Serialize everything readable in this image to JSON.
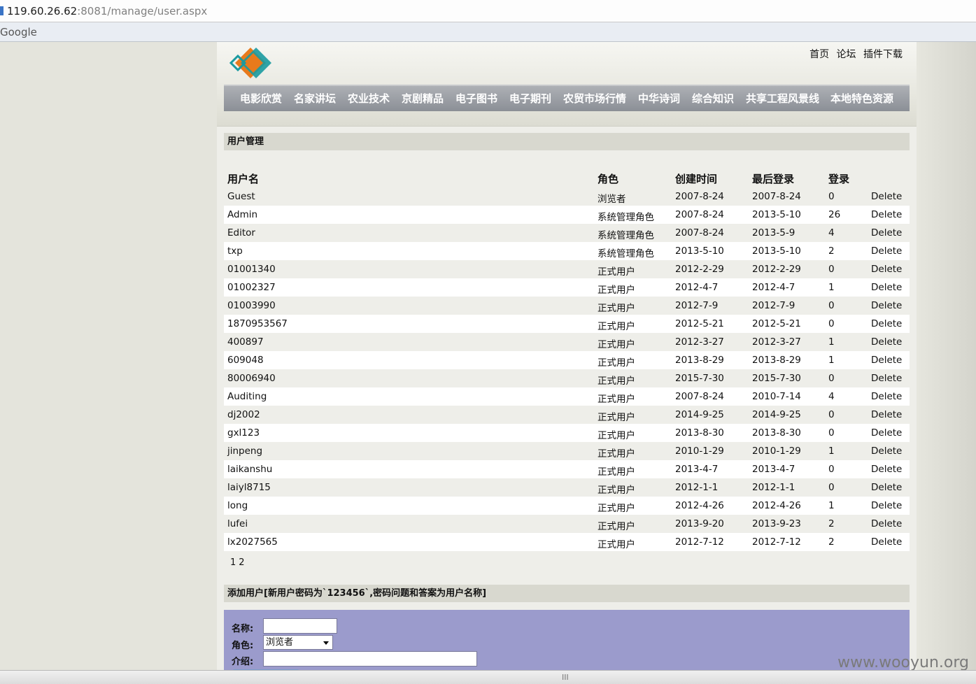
{
  "browser": {
    "url_host": "119.60.26.62",
    "url_path": ":8081/manage/user.aspx",
    "bookmark": "Google"
  },
  "header": {
    "top_links": [
      "首页",
      "论坛",
      "插件下载"
    ],
    "nav": [
      "电影欣赏",
      "名家讲坛",
      "农业技术",
      "京剧精品",
      "电子图书",
      "电子期刊",
      "农贸市场行情",
      "中华诗词",
      "综合知识",
      "共享工程风景线",
      "本地特色资源"
    ],
    "colors": {
      "navbar": "#8b8f96",
      "logo_orange": "#e87a1c",
      "logo_teal": "#1a9aa0"
    }
  },
  "users_section": {
    "title": "用户管理",
    "columns": [
      "用户名",
      "角色",
      "创建时间",
      "最后登录",
      "登录"
    ],
    "rows": [
      [
        "Guest",
        "浏览者",
        "2007-8-24",
        "2007-8-24",
        "0",
        "Delete"
      ],
      [
        "Admin",
        "系统管理角色",
        "2007-8-24",
        "2013-5-10",
        "26",
        "Delete"
      ],
      [
        "Editor",
        "系统管理角色",
        "2007-8-24",
        "2013-5-9",
        "4",
        "Delete"
      ],
      [
        "txp",
        "系统管理角色",
        "2013-5-10",
        "2013-5-10",
        "2",
        "Delete"
      ],
      [
        "01001340",
        "正式用户",
        "2012-2-29",
        "2012-2-29",
        "0",
        "Delete"
      ],
      [
        "01002327",
        "正式用户",
        "2012-4-7",
        "2012-4-7",
        "1",
        "Delete"
      ],
      [
        "01003990",
        "正式用户",
        "2012-7-9",
        "2012-7-9",
        "0",
        "Delete"
      ],
      [
        "1870953567",
        "正式用户",
        "2012-5-21",
        "2012-5-21",
        "0",
        "Delete"
      ],
      [
        "400897",
        "正式用户",
        "2012-3-27",
        "2012-3-27",
        "1",
        "Delete"
      ],
      [
        "609048",
        "正式用户",
        "2013-8-29",
        "2013-8-29",
        "1",
        "Delete"
      ],
      [
        "80006940",
        "正式用户",
        "2015-7-30",
        "2015-7-30",
        "0",
        "Delete"
      ],
      [
        "Auditing",
        "正式用户",
        "2007-8-24",
        "2010-7-14",
        "4",
        "Delete"
      ],
      [
        "dj2002",
        "正式用户",
        "2014-9-25",
        "2014-9-25",
        "0",
        "Delete"
      ],
      [
        "gxl123",
        "正式用户",
        "2013-8-30",
        "2013-8-30",
        "0",
        "Delete"
      ],
      [
        "jinpeng",
        "正式用户",
        "2010-1-29",
        "2010-1-29",
        "1",
        "Delete"
      ],
      [
        "laikanshu",
        "正式用户",
        "2013-4-7",
        "2013-4-7",
        "0",
        "Delete"
      ],
      [
        "laiyl8715",
        "正式用户",
        "2012-1-1",
        "2012-1-1",
        "0",
        "Delete"
      ],
      [
        "long",
        "正式用户",
        "2012-4-26",
        "2012-4-26",
        "1",
        "Delete"
      ],
      [
        "lufei",
        "正式用户",
        "2013-9-20",
        "2013-9-23",
        "2",
        "Delete"
      ],
      [
        "lx2027565",
        "正式用户",
        "2012-7-12",
        "2012-7-12",
        "2",
        "Delete"
      ]
    ],
    "pages": [
      "1",
      "2"
    ]
  },
  "add_section": {
    "title": "添加用户[新用户密码为`123456`,密码问题和答案为用户名称]",
    "name_label": "名称:",
    "role_label": "角色:",
    "role_value": "浏览者",
    "intro_label": "介绍:",
    "form_bg": "#9b9bcc"
  },
  "watermark": "www.wooyun.org",
  "statusbar_grip": "III"
}
